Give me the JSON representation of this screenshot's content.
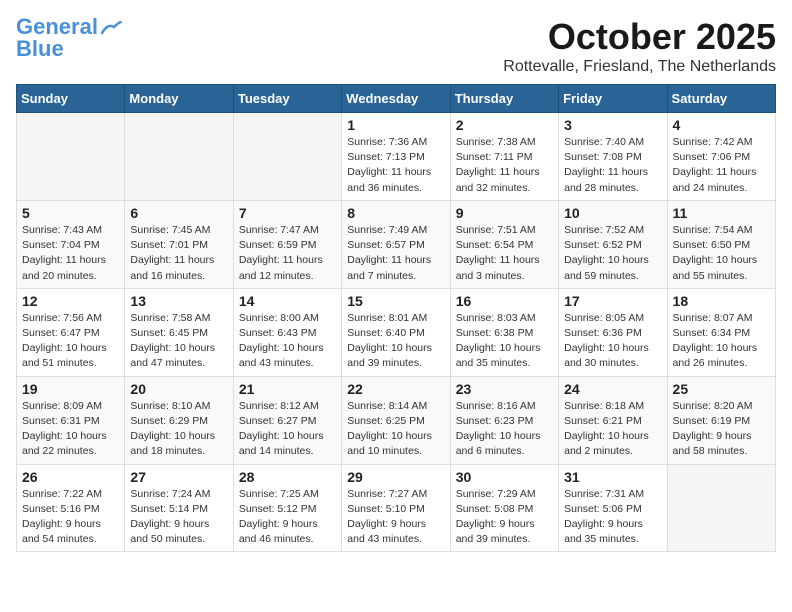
{
  "logo": {
    "line1": "General",
    "line2": "Blue"
  },
  "title": "October 2025",
  "subtitle": "Rottevalle, Friesland, The Netherlands",
  "weekdays": [
    "Sunday",
    "Monday",
    "Tuesday",
    "Wednesday",
    "Thursday",
    "Friday",
    "Saturday"
  ],
  "weeks": [
    [
      {
        "day": "",
        "info": ""
      },
      {
        "day": "",
        "info": ""
      },
      {
        "day": "",
        "info": ""
      },
      {
        "day": "1",
        "info": "Sunrise: 7:36 AM\nSunset: 7:13 PM\nDaylight: 11 hours\nand 36 minutes."
      },
      {
        "day": "2",
        "info": "Sunrise: 7:38 AM\nSunset: 7:11 PM\nDaylight: 11 hours\nand 32 minutes."
      },
      {
        "day": "3",
        "info": "Sunrise: 7:40 AM\nSunset: 7:08 PM\nDaylight: 11 hours\nand 28 minutes."
      },
      {
        "day": "4",
        "info": "Sunrise: 7:42 AM\nSunset: 7:06 PM\nDaylight: 11 hours\nand 24 minutes."
      }
    ],
    [
      {
        "day": "5",
        "info": "Sunrise: 7:43 AM\nSunset: 7:04 PM\nDaylight: 11 hours\nand 20 minutes."
      },
      {
        "day": "6",
        "info": "Sunrise: 7:45 AM\nSunset: 7:01 PM\nDaylight: 11 hours\nand 16 minutes."
      },
      {
        "day": "7",
        "info": "Sunrise: 7:47 AM\nSunset: 6:59 PM\nDaylight: 11 hours\nand 12 minutes."
      },
      {
        "day": "8",
        "info": "Sunrise: 7:49 AM\nSunset: 6:57 PM\nDaylight: 11 hours\nand 7 minutes."
      },
      {
        "day": "9",
        "info": "Sunrise: 7:51 AM\nSunset: 6:54 PM\nDaylight: 11 hours\nand 3 minutes."
      },
      {
        "day": "10",
        "info": "Sunrise: 7:52 AM\nSunset: 6:52 PM\nDaylight: 10 hours\nand 59 minutes."
      },
      {
        "day": "11",
        "info": "Sunrise: 7:54 AM\nSunset: 6:50 PM\nDaylight: 10 hours\nand 55 minutes."
      }
    ],
    [
      {
        "day": "12",
        "info": "Sunrise: 7:56 AM\nSunset: 6:47 PM\nDaylight: 10 hours\nand 51 minutes."
      },
      {
        "day": "13",
        "info": "Sunrise: 7:58 AM\nSunset: 6:45 PM\nDaylight: 10 hours\nand 47 minutes."
      },
      {
        "day": "14",
        "info": "Sunrise: 8:00 AM\nSunset: 6:43 PM\nDaylight: 10 hours\nand 43 minutes."
      },
      {
        "day": "15",
        "info": "Sunrise: 8:01 AM\nSunset: 6:40 PM\nDaylight: 10 hours\nand 39 minutes."
      },
      {
        "day": "16",
        "info": "Sunrise: 8:03 AM\nSunset: 6:38 PM\nDaylight: 10 hours\nand 35 minutes."
      },
      {
        "day": "17",
        "info": "Sunrise: 8:05 AM\nSunset: 6:36 PM\nDaylight: 10 hours\nand 30 minutes."
      },
      {
        "day": "18",
        "info": "Sunrise: 8:07 AM\nSunset: 6:34 PM\nDaylight: 10 hours\nand 26 minutes."
      }
    ],
    [
      {
        "day": "19",
        "info": "Sunrise: 8:09 AM\nSunset: 6:31 PM\nDaylight: 10 hours\nand 22 minutes."
      },
      {
        "day": "20",
        "info": "Sunrise: 8:10 AM\nSunset: 6:29 PM\nDaylight: 10 hours\nand 18 minutes."
      },
      {
        "day": "21",
        "info": "Sunrise: 8:12 AM\nSunset: 6:27 PM\nDaylight: 10 hours\nand 14 minutes."
      },
      {
        "day": "22",
        "info": "Sunrise: 8:14 AM\nSunset: 6:25 PM\nDaylight: 10 hours\nand 10 minutes."
      },
      {
        "day": "23",
        "info": "Sunrise: 8:16 AM\nSunset: 6:23 PM\nDaylight: 10 hours\nand 6 minutes."
      },
      {
        "day": "24",
        "info": "Sunrise: 8:18 AM\nSunset: 6:21 PM\nDaylight: 10 hours\nand 2 minutes."
      },
      {
        "day": "25",
        "info": "Sunrise: 8:20 AM\nSunset: 6:19 PM\nDaylight: 9 hours\nand 58 minutes."
      }
    ],
    [
      {
        "day": "26",
        "info": "Sunrise: 7:22 AM\nSunset: 5:16 PM\nDaylight: 9 hours\nand 54 minutes."
      },
      {
        "day": "27",
        "info": "Sunrise: 7:24 AM\nSunset: 5:14 PM\nDaylight: 9 hours\nand 50 minutes."
      },
      {
        "day": "28",
        "info": "Sunrise: 7:25 AM\nSunset: 5:12 PM\nDaylight: 9 hours\nand 46 minutes."
      },
      {
        "day": "29",
        "info": "Sunrise: 7:27 AM\nSunset: 5:10 PM\nDaylight: 9 hours\nand 43 minutes."
      },
      {
        "day": "30",
        "info": "Sunrise: 7:29 AM\nSunset: 5:08 PM\nDaylight: 9 hours\nand 39 minutes."
      },
      {
        "day": "31",
        "info": "Sunrise: 7:31 AM\nSunset: 5:06 PM\nDaylight: 9 hours\nand 35 minutes."
      },
      {
        "day": "",
        "info": ""
      }
    ]
  ]
}
